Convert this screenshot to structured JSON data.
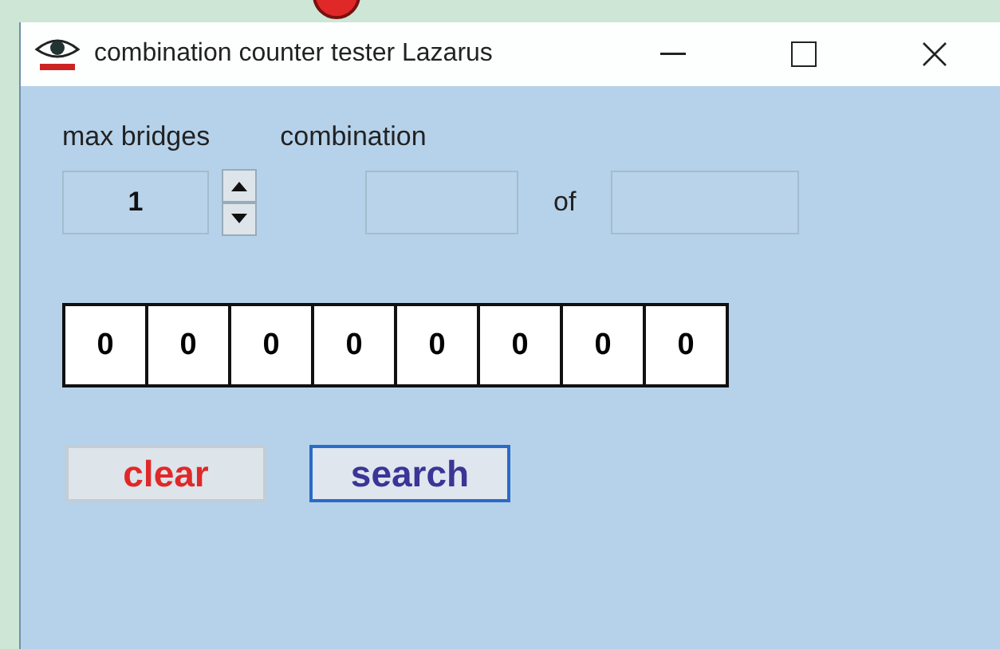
{
  "window": {
    "title": "combination counter tester Lazarus"
  },
  "max_bridges": {
    "label": "max bridges",
    "value": "1"
  },
  "combination": {
    "label": "combination",
    "of_label": "of"
  },
  "digits": [
    "0",
    "0",
    "0",
    "0",
    "0",
    "0",
    "0",
    "0"
  ],
  "buttons": [
    {
      "label": "clear",
      "color": "#e02828",
      "focused": false
    },
    {
      "label": "search",
      "color": "#3a3596",
      "focused": true
    }
  ]
}
